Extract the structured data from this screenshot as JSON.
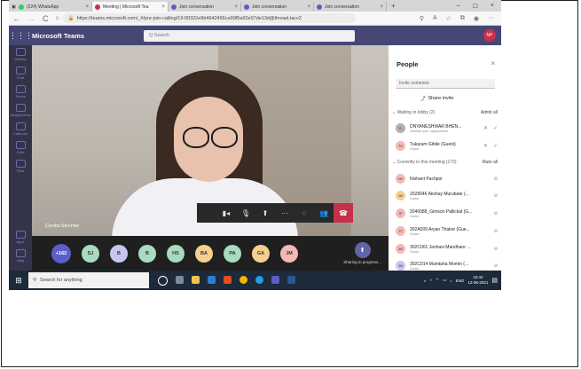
{
  "browser": {
    "tabs": [
      {
        "label": "(224) WhatsApp",
        "color": "#25d366"
      },
      {
        "label": "Meeting | Microsoft Tea",
        "color": "#c4314b",
        "active": true
      },
      {
        "label": "Join conversation",
        "color": "#5b5fc7"
      },
      {
        "label": "Join conversation",
        "color": "#5b5fc7"
      },
      {
        "label": "Join conversation",
        "color": "#5b5fc7"
      }
    ],
    "new_tab": "+",
    "url": "https://teams.microsoft.com/_#/pre-join-calling/19:00322e9b4642466ca99f5a92e07de13d@thread.tacv2"
  },
  "teams": {
    "app_title": "Microsoft Teams",
    "search_placeholder": "Q Search",
    "avatar_initials": "NP"
  },
  "rail": [
    {
      "label": "Activity"
    },
    {
      "label": "Chat"
    },
    {
      "label": "Teams"
    },
    {
      "label": "Assignments"
    },
    {
      "label": "Calendar"
    },
    {
      "label": "Calls"
    },
    {
      "label": "Files"
    }
  ],
  "rail_bottom": [
    {
      "label": "Apps"
    },
    {
      "label": "Help"
    }
  ],
  "video": {
    "speaker_name": "Cecilia Sicorme"
  },
  "participants_bar": {
    "more_count": "+162",
    "avatars": [
      {
        "initials": "SJ",
        "color": "#a9dbc1"
      },
      {
        "initials": "B",
        "color": "#c8c6ee"
      },
      {
        "initials": "B",
        "color": "#a9dbc1"
      },
      {
        "initials": "HS",
        "color": "#a9dbc1"
      },
      {
        "initials": "BA",
        "color": "#f6d08f"
      },
      {
        "initials": "PA",
        "color": "#a9dbc1"
      },
      {
        "initials": "GA",
        "color": "#f6d08f"
      },
      {
        "initials": "JM",
        "color": "#f4b9b6"
      }
    ],
    "sharing_label": "Sharing in progress..."
  },
  "people": {
    "title": "People",
    "invite_placeholder": "Invite someone",
    "share_invite": "Share invite",
    "lobby_header": "Waiting in lobby (2)",
    "admit_all": "Admit all",
    "lobby": [
      {
        "name": "DNYANESHWAR BHEN...",
        "sub": "Outside your organization",
        "initials": "D",
        "color": "#b3b0ad"
      },
      {
        "name": "Tukaram Gibile (Guest)",
        "sub": "Guest",
        "initials": "TG",
        "color": "#f4b9b6"
      }
    ],
    "meeting_header": "Currently in this meeting (172)",
    "mute_all": "Mute all",
    "members": [
      {
        "name": "Nishant Pachpor",
        "sub": "",
        "initials": "NP",
        "color": "#f4b9b6"
      },
      {
        "name": "2028046 Akshay Murubate (...",
        "sub": "Guest",
        "initials": "2M",
        "color": "#f6d08f"
      },
      {
        "name": "2040088_Gimson Pallickal (G...",
        "sub": "Guest",
        "initials": "2P",
        "color": "#f4b9b6"
      },
      {
        "name": "302A009 Aryan Thakre (Gue...",
        "sub": "Guest",
        "initials": "3T",
        "color": "#f4b9b6"
      },
      {
        "name": "302C001 Janhavi Mandhare ...",
        "sub": "Guest",
        "initials": "3M",
        "color": "#f4b9b6"
      },
      {
        "name": "302C014 Mumtaha Momin (...",
        "sub": "Guest",
        "initials": "3M",
        "color": "#c8c6ee"
      }
    ]
  },
  "taskbar": {
    "search_placeholder": "Search for anything",
    "tray_lang": "ENG",
    "time": "16:42",
    "date": "12-05-2021"
  }
}
